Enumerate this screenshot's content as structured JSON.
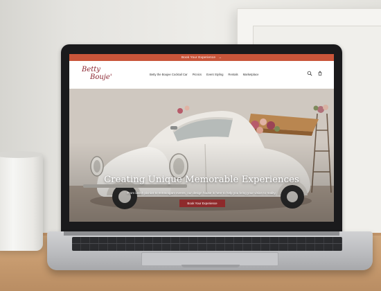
{
  "site": {
    "promo_bar": {
      "label": "Book Your Experience",
      "arrow": "→"
    },
    "logo": {
      "line1": "Betty",
      "line2": "Bouje'"
    },
    "nav": [
      {
        "label": "Betty the Boujee Cocktail Car"
      },
      {
        "label": "Picnics"
      },
      {
        "label": "Event Styling"
      },
      {
        "label": "Rentals"
      },
      {
        "label": "Marketplace"
      }
    ],
    "header_icons": [
      "search-icon",
      "cart-icon"
    ],
    "hero": {
      "headline": "Creating Unique Memorable Experiences",
      "subtext": "From lavish picnics to extravagant events, our design house is here to help you bring your vision to reality.",
      "cta_label": "Book Your Experience"
    }
  },
  "colors": {
    "promo_bar": "#c9553a",
    "cta": "#8e2a2b",
    "logo": "#8a2530"
  }
}
